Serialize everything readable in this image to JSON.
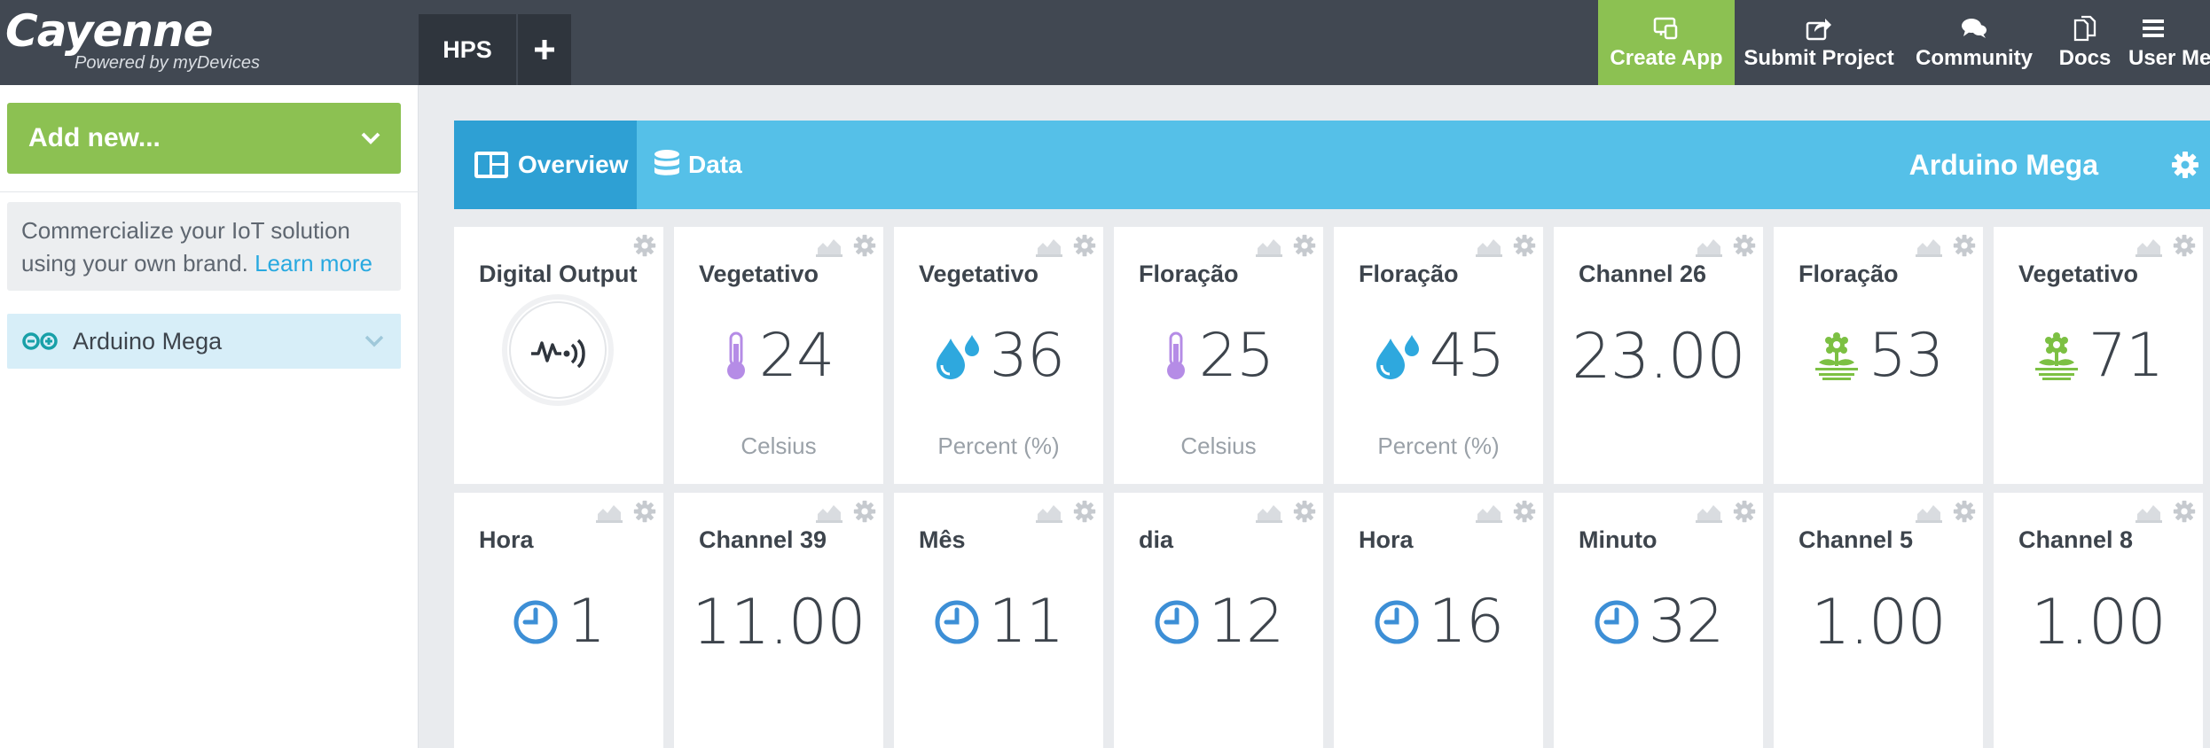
{
  "app": {
    "brand": "Cayenne",
    "tagline": "Powered by myDevices"
  },
  "project_tab": {
    "label": "HPS"
  },
  "nav": {
    "create_app": "Create App",
    "submit_project": "Submit Project",
    "community": "Community",
    "docs": "Docs",
    "user_menu": "User Me"
  },
  "sidebar": {
    "add_new": "Add new...",
    "promo_text": "Commercialize your IoT solution using your own brand.",
    "promo_link": "Learn more",
    "device": "Arduino Mega"
  },
  "device_bar": {
    "tab_overview": "Overview",
    "tab_data": "Data",
    "device_name": "Arduino Mega"
  },
  "widgets_row1": [
    {
      "title": "Digital Output",
      "kind": "digital",
      "icon": "digital-output-icon"
    },
    {
      "title": "Vegetativo",
      "value": "24",
      "unit": "Celsius",
      "icon": "thermometer-icon"
    },
    {
      "title": "Vegetativo",
      "value": "36",
      "unit": "Percent (%)",
      "icon": "humidity-drops-icon"
    },
    {
      "title": "Floração",
      "value": "25",
      "unit": "Celsius",
      "icon": "thermometer-icon"
    },
    {
      "title": "Floração",
      "value": "45",
      "unit": "Percent (%)",
      "icon": "humidity-drops-icon"
    },
    {
      "title": "Channel 26",
      "value": "23.00",
      "unit": "",
      "icon": ""
    },
    {
      "title": "Floração",
      "value": "53",
      "unit": "",
      "icon": "plant-icon"
    },
    {
      "title": "Vegetativo",
      "value": "71",
      "unit": "",
      "icon": "plant-icon"
    }
  ],
  "widgets_row2": [
    {
      "title": "Hora",
      "value": "1",
      "icon": "clock-icon"
    },
    {
      "title": "Channel 39",
      "value": "11.00",
      "icon": ""
    },
    {
      "title": "Mês",
      "value": "11",
      "icon": "clock-icon"
    },
    {
      "title": "dia",
      "value": "12",
      "icon": "clock-icon"
    },
    {
      "title": "Hora",
      "value": "16",
      "icon": "clock-icon"
    },
    {
      "title": "Minuto",
      "value": "32",
      "icon": "clock-icon"
    },
    {
      "title": "Channel 5",
      "value": "1.00",
      "icon": ""
    },
    {
      "title": "Channel 8",
      "value": "1.00",
      "icon": ""
    }
  ],
  "colors": {
    "topbar": "#414852",
    "accent_green": "#8cc152",
    "device_bar": "#55c0e8",
    "tab_active": "#2ea0d4",
    "link": "#28a9e0",
    "thermo": "#b58ce6",
    "drops": "#2ea8de",
    "plant": "#7cc043",
    "clock": "#3d8fd6"
  }
}
